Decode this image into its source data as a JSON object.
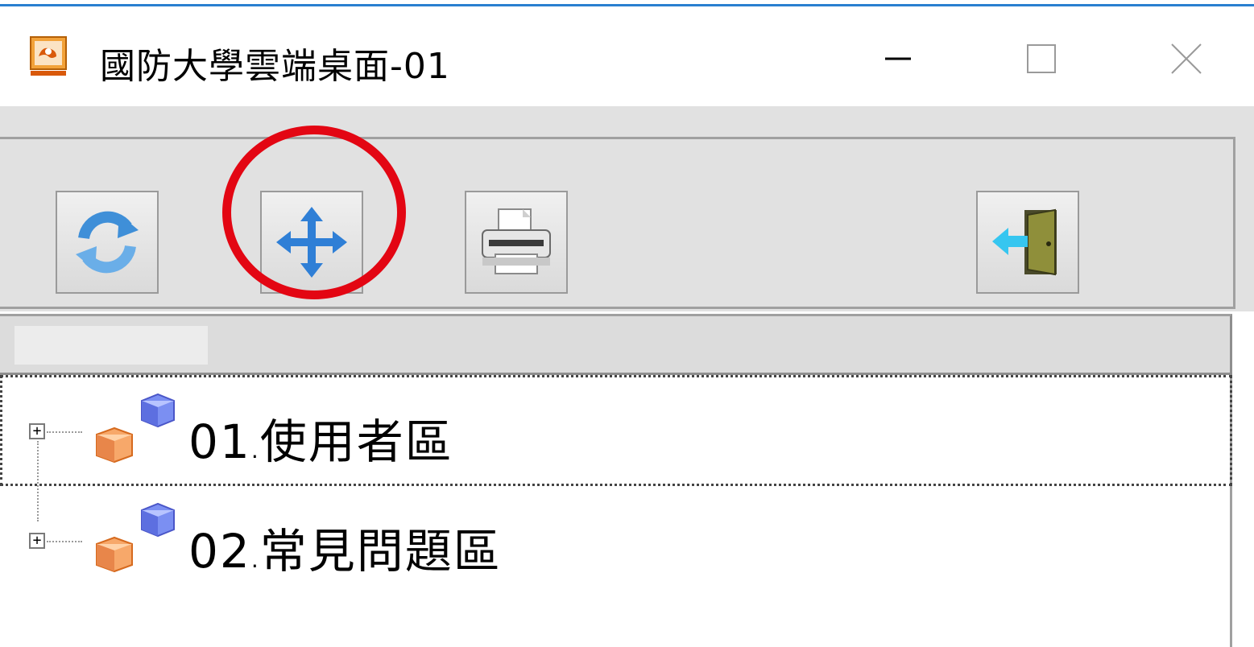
{
  "window": {
    "title": "國防大學雲端桌面-01",
    "app_icon": "remote-desktop-icon",
    "controls": {
      "minimize": "minimize-icon",
      "maximize": "maximize-icon",
      "close": "close-icon"
    }
  },
  "toolbar": {
    "buttons": [
      {
        "name": "refresh-button",
        "icon": "refresh-icon"
      },
      {
        "name": "move-button",
        "icon": "move-arrows-icon",
        "highlighted": true
      },
      {
        "name": "print-button",
        "icon": "printer-icon"
      },
      {
        "name": "exit-button",
        "icon": "exit-door-icon"
      }
    ]
  },
  "tree": {
    "items": [
      {
        "number": "01",
        "dot": ".",
        "label": "使用者區",
        "expander": "+",
        "icon": "folder-cubes-icon",
        "selected": true
      },
      {
        "number": "02",
        "dot": ".",
        "label": "常見問題區",
        "expander": "+",
        "icon": "folder-cubes-icon",
        "selected": false
      }
    ]
  },
  "colors": {
    "highlight_ring": "#e30613",
    "toolbar_bg": "#e1e1e1",
    "title_accent": "#2a7fd0"
  }
}
